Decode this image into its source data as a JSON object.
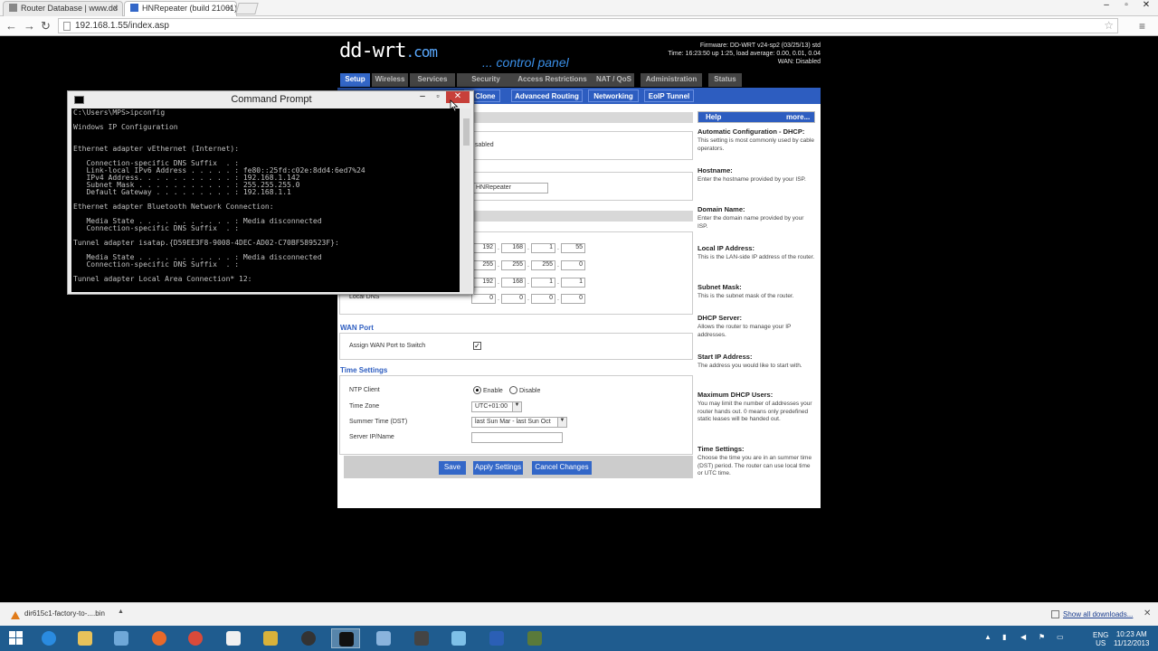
{
  "browser": {
    "tabs": [
      {
        "title": "Router Database | www.dd"
      },
      {
        "title": "HNRepeater (build 21061)"
      }
    ],
    "url": "192.168.1.55/index.asp"
  },
  "ddwrt": {
    "logo": "dd-wrt",
    "logo_suffix": ".com",
    "panel_label": "... control panel",
    "firmware": "Firmware: DD-WRT v24-sp2 (03/25/13) std",
    "time": "Time: 16:23:50 up 1:25, load average: 0.00, 0.01, 0.04",
    "wan": "WAN: Disabled",
    "main_tabs": [
      "Setup",
      "Wireless",
      "Services",
      "Security",
      "Access Restrictions",
      "NAT / QoS",
      "Administration",
      "Status"
    ],
    "sub_tabs": [
      "s Clone",
      "Advanced Routing",
      "Networking",
      "EoIP Tunnel"
    ],
    "partial_disabled": "sabled",
    "hostname_value": "HNRepeater",
    "local_ip": [
      "192",
      "168",
      "1",
      "55"
    ],
    "subnet_mask": [
      "255",
      "255",
      "255",
      "0"
    ],
    "gateway": [
      "192",
      "168",
      "1",
      "1"
    ],
    "local_dns_label": "Local DNS",
    "local_dns": [
      "0",
      "0",
      "0",
      "0"
    ],
    "wan_port_title": "WAN Port",
    "assign_wan_label": "Assign WAN Port to Switch",
    "time_settings_title": "Time Settings",
    "ntp_label": "NTP Client",
    "enable_label": "Enable",
    "disable_label": "Disable",
    "timezone_label": "Time Zone",
    "timezone_value": "UTC+01:00",
    "dst_label": "Summer Time (DST)",
    "dst_value": "last Sun Mar - last Sun Oct",
    "server_label": "Server IP/Name",
    "server_value": "",
    "buttons": {
      "save": "Save",
      "apply": "Apply Settings",
      "cancel": "Cancel Changes"
    },
    "help": {
      "title": "Help",
      "more": "more...",
      "items": [
        {
          "title": "Automatic Configuration - DHCP:",
          "text": "This setting is most commonly used by cable operators."
        },
        {
          "title": "Hostname:",
          "text": "Enter the hostname provided by your ISP."
        },
        {
          "title": "Domain Name:",
          "text": "Enter the domain name provided by your ISP."
        },
        {
          "title": "Local IP Address:",
          "text": "This is the LAN-side IP address of the router."
        },
        {
          "title": "Subnet Mask:",
          "text": "This is the subnet mask of the router."
        },
        {
          "title": "DHCP Server:",
          "text": "Allows the router to manage your IP addresses."
        },
        {
          "title": "Start IP Address:",
          "text": "The address you would like to start with."
        },
        {
          "title": "Maximum DHCP Users:",
          "text": "You may limit the number of addresses your router hands out. 0 means only predefined static leases will be handed out."
        },
        {
          "title": "Time Settings:",
          "text": "Choose the time you are in an summer time (DST) period. The router can use local time or UTC time."
        }
      ]
    }
  },
  "cmd": {
    "title": "Command Prompt",
    "lines": [
      "C:\\Users\\MPS>ipconfig",
      "",
      "Windows IP Configuration",
      "",
      "",
      "Ethernet adapter vEthernet (Internet):",
      "",
      "   Connection-specific DNS Suffix  . :",
      "   Link-local IPv6 Address . . . . . : fe80::25fd:c02e:8dd4:6ed7%24",
      "   IPv4 Address. . . . . . . . . . . : 192.168.1.142",
      "   Subnet Mask . . . . . . . . . . . : 255.255.255.0",
      "   Default Gateway . . . . . . . . . : 192.168.1.1",
      "",
      "Ethernet adapter Bluetooth Network Connection:",
      "",
      "   Media State . . . . . . . . . . . : Media disconnected",
      "   Connection-specific DNS Suffix  . :",
      "",
      "Tunnel adapter isatap.{D59EE3F8-9008-4DEC-AD02-C70BF589523F}:",
      "",
      "   Media State . . . . . . . . . . . : Media disconnected",
      "   Connection-specific DNS Suffix  . :",
      "",
      "Tunnel adapter Local Area Connection* 12:"
    ]
  },
  "downloads": {
    "file": "dir615c1-factory-to-....bin",
    "show_all": "Show all downloads..."
  },
  "taskbar": {
    "lang_top": "ENG",
    "lang_bottom": "US",
    "time": "10:23 AM",
    "date": "11/12/2013"
  }
}
